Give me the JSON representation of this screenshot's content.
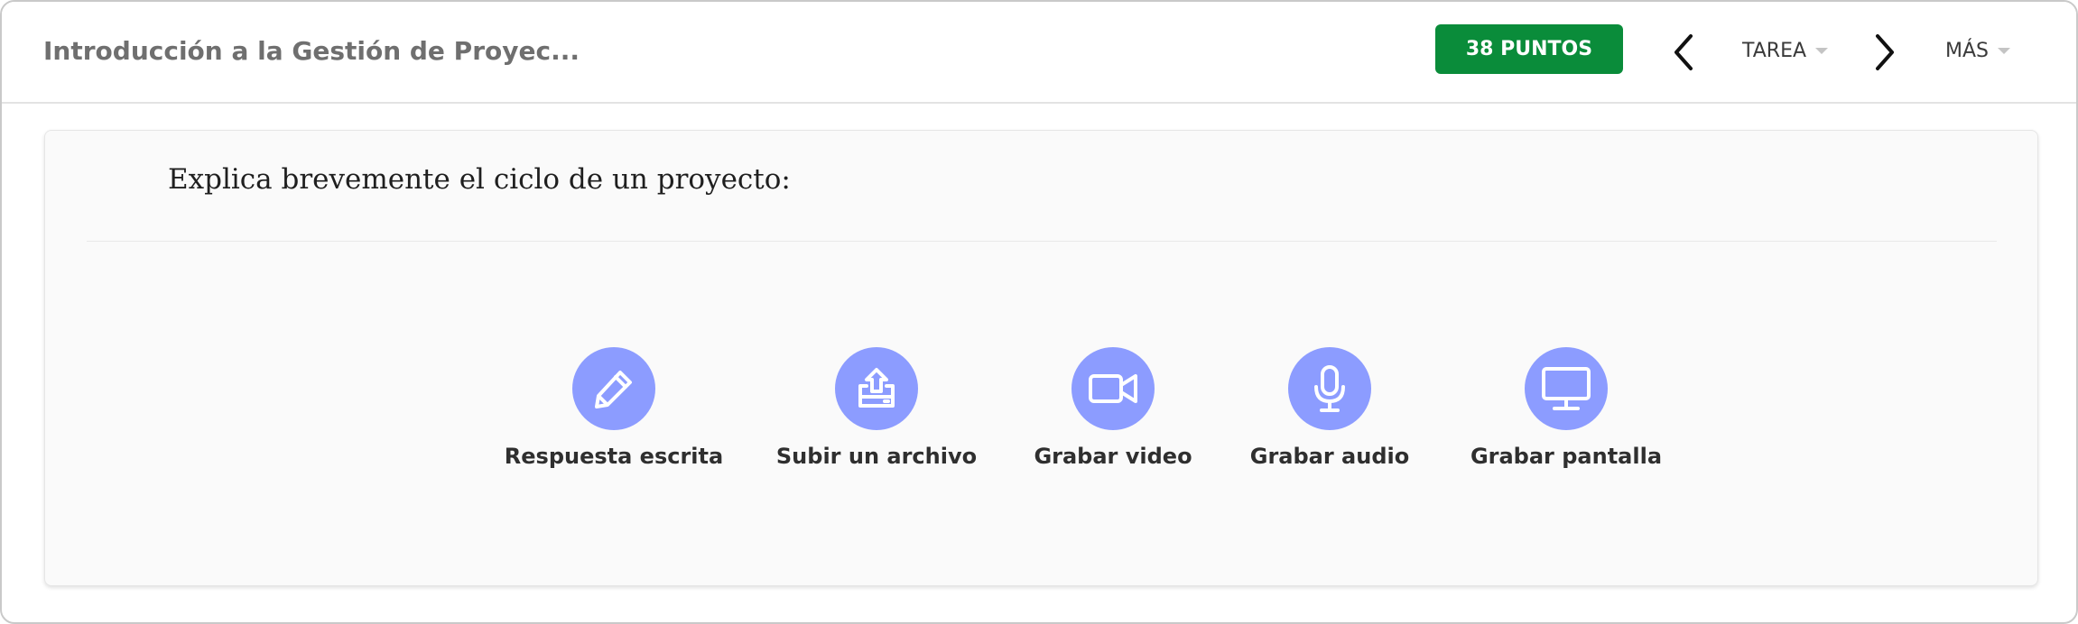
{
  "header": {
    "course_title": "Introducción a la Gestión de Proyec...",
    "points_badge": "38 PUNTOS",
    "nav": {
      "prev_icon": "chevron-left-icon",
      "next_icon": "chevron-right-icon",
      "tarea_label": "TAREA",
      "mas_label": "MÁS"
    }
  },
  "card": {
    "question": "Explica brevemente el ciclo de un proyecto:",
    "options": [
      {
        "label": "Respuesta escrita",
        "icon": "pencil-icon"
      },
      {
        "label": "Subir un archivo",
        "icon": "upload-icon"
      },
      {
        "label": "Grabar video",
        "icon": "video-camera-icon"
      },
      {
        "label": "Grabar audio",
        "icon": "microphone-icon"
      },
      {
        "label": "Grabar pantalla",
        "icon": "monitor-icon"
      }
    ]
  },
  "colors": {
    "points_badge_bg": "#0a8c3a",
    "option_circle": "#8c9cff",
    "title_text": "#6f6f6f"
  }
}
